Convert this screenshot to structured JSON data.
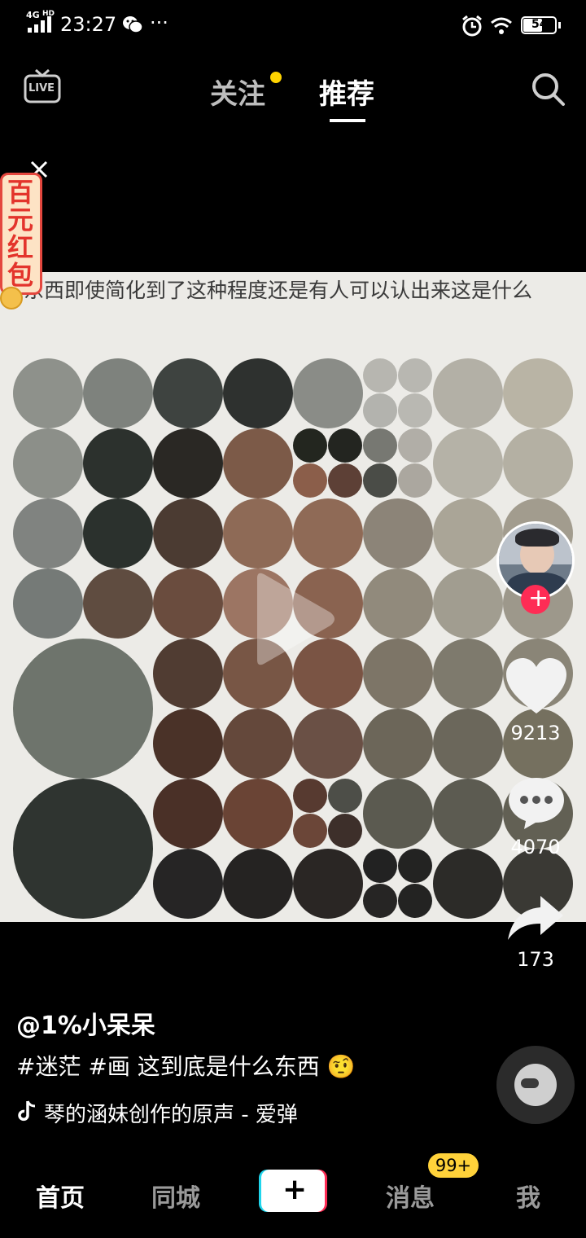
{
  "status": {
    "network": "4G",
    "network_sub": "HD",
    "time": "23:27",
    "battery": "54"
  },
  "topnav": {
    "follow_label": "关注",
    "recommend_label": "推荐",
    "live_label": "LIVE"
  },
  "redpacket": {
    "text_chars": [
      "百",
      "元",
      "红",
      "包"
    ]
  },
  "video": {
    "caption": "这东西即使简化到了这种程度还是有人可以认出来这是什么"
  },
  "actions": {
    "likes": "9213",
    "comments": "4070",
    "shares": "173"
  },
  "post": {
    "author": "@1%小呆呆",
    "description": "#迷茫 #画 这到底是什么东西",
    "emoji": "🤨",
    "music": "琴的涵妹创作的原声 - 爱弹"
  },
  "bottomnav": {
    "home": "首页",
    "city": "同城",
    "add": "+",
    "messages": "消息",
    "messages_badge": "99+",
    "me": "我"
  },
  "colors": {
    "accent_red": "#fe2c55",
    "badge_yellow": "#ffd23a",
    "dot_yellow": "#ffd400"
  }
}
